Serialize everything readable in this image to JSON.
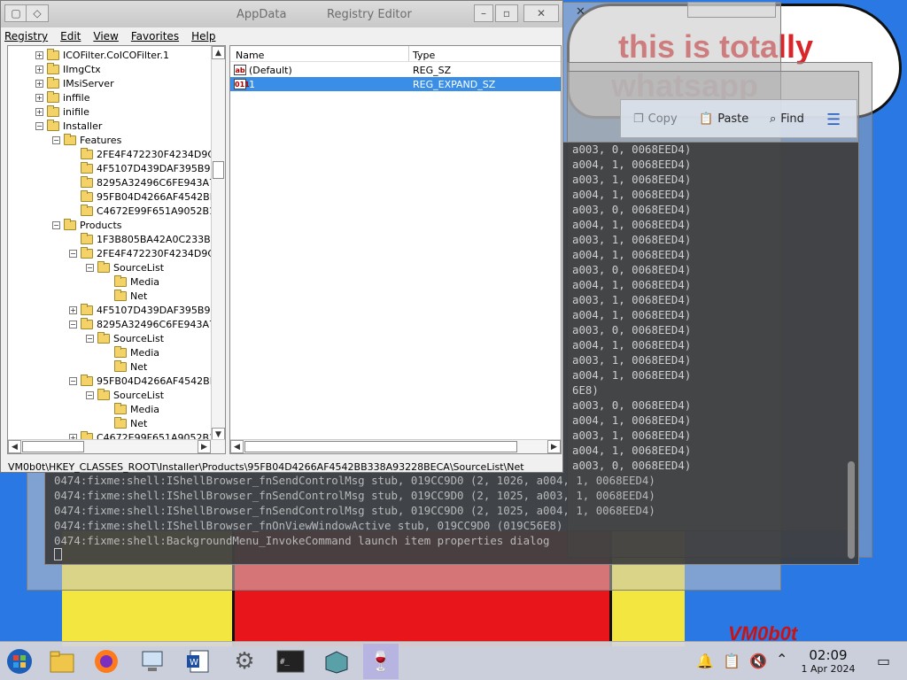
{
  "registry": {
    "title_path": "AppData",
    "title": "Registry Editor",
    "menu": [
      "Registry",
      "Edit",
      "View",
      "Favorites",
      "Help"
    ],
    "tree": [
      {
        "label": "ICOFilter.CoICOFilter.1",
        "level": 2,
        "expander": "+"
      },
      {
        "label": "IImgCtx",
        "level": 2,
        "expander": "+"
      },
      {
        "label": "IMsiServer",
        "level": 2,
        "expander": "+"
      },
      {
        "label": "inffile",
        "level": 2,
        "expander": "+"
      },
      {
        "label": "inifile",
        "level": 2,
        "expander": "+"
      },
      {
        "label": "Installer",
        "level": 2,
        "expander": "-"
      },
      {
        "label": "Features",
        "level": 3,
        "expander": "-"
      },
      {
        "label": "2FE4F472230F4234D9C",
        "level": 4,
        "expander": ""
      },
      {
        "label": "4F5107D439DAF395B93",
        "level": 4,
        "expander": ""
      },
      {
        "label": "8295A32496C6FE943A7",
        "level": 4,
        "expander": ""
      },
      {
        "label": "95FB04D4266AF4542BE",
        "level": 4,
        "expander": ""
      },
      {
        "label": "C4672E99F651A9052B1",
        "level": 4,
        "expander": ""
      },
      {
        "label": "Products",
        "level": 3,
        "expander": "-"
      },
      {
        "label": "1F3B805BA42A0C233B0",
        "level": 4,
        "expander": ""
      },
      {
        "label": "2FE4F472230F4234D9C",
        "level": 4,
        "expander": "-"
      },
      {
        "label": "SourceList",
        "level": 5,
        "expander": "-"
      },
      {
        "label": "Media",
        "level": 6,
        "expander": ""
      },
      {
        "label": "Net",
        "level": 6,
        "expander": ""
      },
      {
        "label": "4F5107D439DAF395B93",
        "level": 4,
        "expander": "+"
      },
      {
        "label": "8295A32496C6FE943A7",
        "level": 4,
        "expander": "-"
      },
      {
        "label": "SourceList",
        "level": 5,
        "expander": "-"
      },
      {
        "label": "Media",
        "level": 6,
        "expander": ""
      },
      {
        "label": "Net",
        "level": 6,
        "expander": ""
      },
      {
        "label": "95FB04D4266AF4542BE",
        "level": 4,
        "expander": "-"
      },
      {
        "label": "SourceList",
        "level": 5,
        "expander": "-"
      },
      {
        "label": "Media",
        "level": 6,
        "expander": ""
      },
      {
        "label": "Net",
        "level": 6,
        "expander": ""
      },
      {
        "label": "C4672E99F651A9052B1",
        "level": 4,
        "expander": "+"
      }
    ],
    "columns": {
      "name": "Name",
      "type": "Type"
    },
    "values": [
      {
        "name": "(Default)",
        "type": "REG_SZ",
        "icon": "ab",
        "selected": false
      },
      {
        "name": "1",
        "type": "REG_EXPAND_SZ",
        "icon": "011",
        "selected": true
      }
    ],
    "status": "VM0b0t\\HKEY_CLASSES_ROOT\\Installer\\Products\\95FB04D4266AF4542BB338A93228BECA\\SourceList\\Net"
  },
  "terminal": {
    "right_fragments": [
      "a003, 0, 0068EED4)",
      "a004, 1, 0068EED4)",
      "a003, 1, 0068EED4)",
      "a004, 1, 0068EED4)",
      "a003, 0, 0068EED4)",
      "a004, 1, 0068EED4)",
      "a003, 1, 0068EED4)",
      "a004, 1, 0068EED4)",
      "a003, 0, 0068EED4)",
      "a004, 1, 0068EED4)",
      "a003, 1, 0068EED4)",
      "a004, 1, 0068EED4)",
      "a003, 0, 0068EED4)",
      "a004, 1, 0068EED4)",
      "a003, 1, 0068EED4)",
      "a004, 1, 0068EED4)",
      "6E8)",
      "a003, 0, 0068EED4)",
      "a004, 1, 0068EED4)",
      "a003, 1, 0068EED4)",
      "a004, 1, 0068EED4)",
      "a003, 0, 0068EED4)"
    ],
    "lines": [
      "0474:fixme:shell:IShellBrowser_fnSendControlMsg stub, 019CC9D0 (2, 1026, a004, 1, 0068EED4)",
      "0474:fixme:shell:IShellBrowser_fnSendControlMsg stub, 019CC9D0 (2, 1025, a003, 1, 0068EED4)",
      "0474:fixme:shell:IShellBrowser_fnSendControlMsg stub, 019CC9D0 (2, 1025, a004, 1, 0068EED4)",
      "0474:fixme:shell:IShellBrowser_fnOnViewWindowActive stub, 019CC9D0 (019C56E8)",
      "0474:fixme:shell:BackgroundMenu_InvokeCommand launch item properties dialog"
    ],
    "toolbar": {
      "copy": "Copy",
      "paste": "Paste",
      "find": "Find"
    }
  },
  "desktop": {
    "wallpaper_text": "this is totally",
    "wallpaper_text2": "whatsapp",
    "signature": "VM0b0t"
  },
  "taskbar": {
    "time": "02:09",
    "date": "1 Apr 2024"
  }
}
